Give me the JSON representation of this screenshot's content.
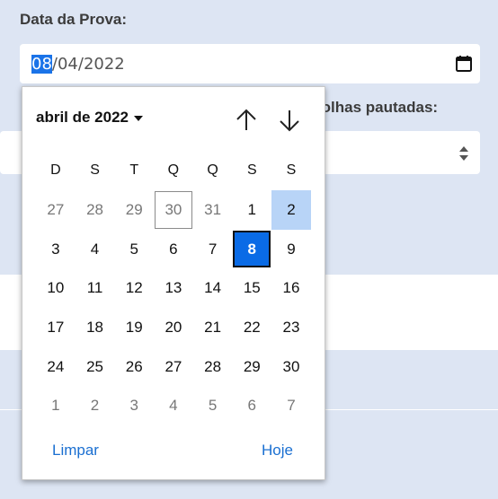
{
  "form": {
    "date_label": "Data da Prova:",
    "date_value": {
      "day": "08",
      "rest": "/04/2022"
    },
    "second_label": "folhas pautadas:"
  },
  "calendar": {
    "month_label": "abril de 2022",
    "weekdays": [
      "D",
      "S",
      "T",
      "Q",
      "Q",
      "S",
      "S"
    ],
    "weeks": [
      [
        "27",
        "28",
        "29",
        "30",
        "31",
        "1",
        "2"
      ],
      [
        "3",
        "4",
        "5",
        "6",
        "7",
        "8",
        "9"
      ],
      [
        "10",
        "11",
        "12",
        "13",
        "14",
        "15",
        "16"
      ],
      [
        "17",
        "18",
        "19",
        "20",
        "21",
        "22",
        "23"
      ],
      [
        "24",
        "25",
        "26",
        "27",
        "28",
        "29",
        "30"
      ],
      [
        "1",
        "2",
        "3",
        "4",
        "5",
        "6",
        "7"
      ]
    ],
    "clear_label": "Limpar",
    "today_label": "Hoje",
    "selected_day": "8",
    "colors": {
      "accent": "#0a6be6",
      "hover": "#b8d4f7",
      "link": "#1a6fd1"
    }
  }
}
